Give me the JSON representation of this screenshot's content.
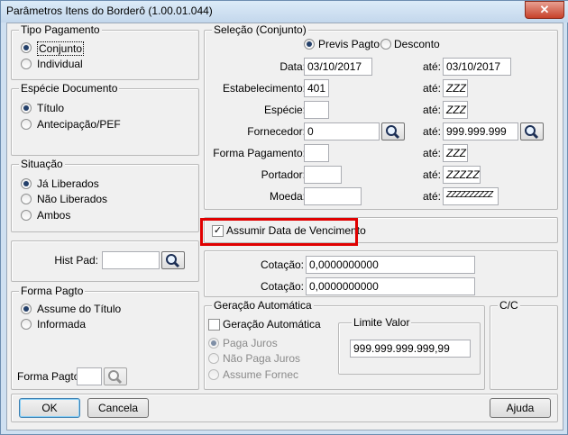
{
  "window": {
    "title": "Parâmetros Itens do Borderô (1.00.01.044)",
    "close_glyph": "✕"
  },
  "tipo_pagamento": {
    "legend": "Tipo Pagamento",
    "options": [
      "Conjunto",
      "Individual"
    ],
    "selected": "Conjunto"
  },
  "especie_documento": {
    "legend": "Espécie Documento",
    "options": [
      "Título",
      "Antecipação/PEF"
    ],
    "selected": "Título"
  },
  "situacao": {
    "legend": "Situação",
    "options": [
      "Já Liberados",
      "Não Liberados",
      "Ambos"
    ],
    "selected": "Já Liberados"
  },
  "hist_pad": {
    "label": "Hist Pad:",
    "value": ""
  },
  "forma_pagto": {
    "legend": "Forma Pagto",
    "options": [
      "Assume do Título",
      "Informada"
    ],
    "selected": "Assume do Título",
    "field_label": "Forma Pagto:",
    "value": ""
  },
  "selecao": {
    "legend": "Seleção (Conjunto)",
    "date_options": [
      "Previs Pagto",
      "Desconto"
    ],
    "date_selected": "Previs Pagto",
    "ate": "até:",
    "rows": {
      "data": {
        "label": "Data:",
        "from": "03/10/2017",
        "to": "03/10/2017"
      },
      "estabelecimento": {
        "label": "Estabelecimento:",
        "from": "401",
        "to": "ZZZ"
      },
      "especie": {
        "label": "Espécie:",
        "from": "",
        "to": "ZZZ"
      },
      "fornecedor": {
        "label": "Fornecedor:",
        "from": "0",
        "to": "999.999.999"
      },
      "forma_pagamento": {
        "label": "Forma Pagamento:",
        "from": "",
        "to": "ZZZ"
      },
      "portador": {
        "label": "Portador:",
        "from": "",
        "to": "ZZZZZ"
      },
      "moeda": {
        "label": "Moeda:",
        "from": "",
        "to": "ZZZZZZZZZZ"
      }
    }
  },
  "assumir": {
    "label": "Assumir Data de Vencimento",
    "checked": true,
    "check_glyph": "✓"
  },
  "cotacao": {
    "label1": "Cotação:",
    "value1": "0,0000000000",
    "label2": "Cotação:",
    "value2": "0,0000000000"
  },
  "geracao": {
    "legend": "Geração Automática",
    "checkbox_label": "Geração Automática",
    "checked": false,
    "options": [
      "Paga Juros",
      "Não Paga Juros",
      "Assume Fornec"
    ],
    "selected": "Paga Juros",
    "limite_legend": "Limite Valor",
    "limite_value": "999.999.999.999,99"
  },
  "cc": {
    "legend": "C/C"
  },
  "buttons": {
    "ok": "OK",
    "cancel": "Cancela",
    "help": "Ajuda"
  },
  "colors": {
    "highlight": "#e00000",
    "titlebar": "#c3d7ec"
  }
}
